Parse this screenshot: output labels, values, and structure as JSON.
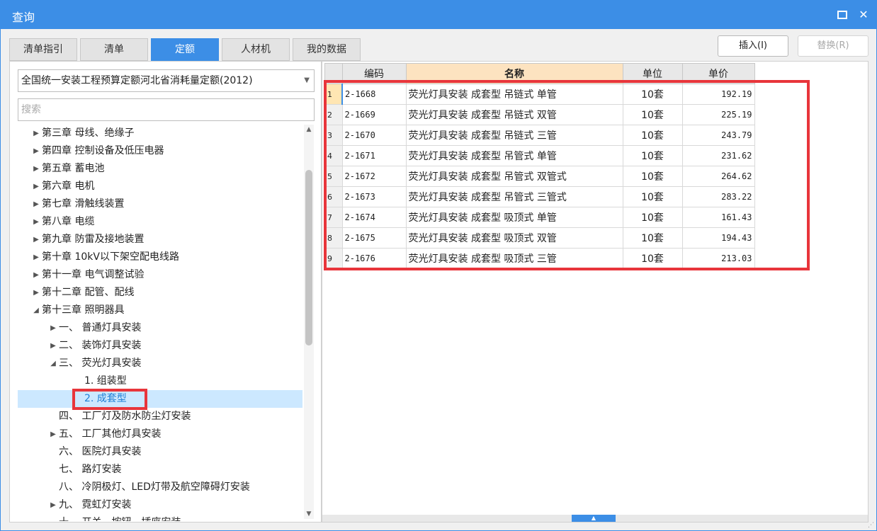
{
  "window": {
    "title": "查询"
  },
  "tabs": [
    {
      "label": "清单指引",
      "active": false
    },
    {
      "label": "清单",
      "active": false
    },
    {
      "label": "定额",
      "active": true
    },
    {
      "label": "人材机",
      "active": false
    },
    {
      "label": "我的数据",
      "active": false
    }
  ],
  "actions": {
    "insert_label": "插入(I)",
    "replace_label": "替换(R)"
  },
  "left": {
    "quota_book": "全国统一安装工程预算定额河北省消耗量定额(2012)",
    "search_placeholder": "搜索",
    "tree": [
      {
        "label": "第三章 母线、绝缘子",
        "toggle": "expand",
        "level": 0
      },
      {
        "label": "第四章 控制设备及低压电器",
        "toggle": "expand",
        "level": 0
      },
      {
        "label": "第五章 蓄电池",
        "toggle": "expand",
        "level": 0
      },
      {
        "label": "第六章 电机",
        "toggle": "expand",
        "level": 0
      },
      {
        "label": "第七章 滑触线装置",
        "toggle": "expand",
        "level": 0
      },
      {
        "label": "第八章 电缆",
        "toggle": "expand",
        "level": 0
      },
      {
        "label": "第九章 防雷及接地装置",
        "toggle": "expand",
        "level": 0
      },
      {
        "label": "第十章 10kV以下架空配电线路",
        "toggle": "expand",
        "level": 0
      },
      {
        "label": "第十一章 电气调整试验",
        "toggle": "expand",
        "level": 0
      },
      {
        "label": "第十二章 配管、配线",
        "toggle": "expand",
        "level": 0
      },
      {
        "label": "第十三章 照明器具",
        "toggle": "collapse",
        "level": 0
      },
      {
        "label": "一、  普通灯具安装",
        "toggle": "expand",
        "level": 1
      },
      {
        "label": "二、  装饰灯具安装",
        "toggle": "expand",
        "level": 1
      },
      {
        "label": "三、  荧光灯具安装",
        "toggle": "collapse",
        "level": 1
      },
      {
        "label": "1. 组装型",
        "toggle": "none",
        "level": 2
      },
      {
        "label": "2. 成套型",
        "toggle": "none",
        "level": 2,
        "selected": true
      },
      {
        "label": "四、  工厂灯及防水防尘灯安装",
        "toggle": "none",
        "level": 1
      },
      {
        "label": "五、  工厂其他灯具安装",
        "toggle": "expand",
        "level": 1
      },
      {
        "label": "六、  医院灯具安装",
        "toggle": "none",
        "level": 1
      },
      {
        "label": "七、  路灯安装",
        "toggle": "none",
        "level": 1
      },
      {
        "label": "八、  冷阴极灯、LED灯带及航空障碍灯安装",
        "toggle": "none",
        "level": 1
      },
      {
        "label": "九、  霓虹灯安装",
        "toggle": "expand",
        "level": 1
      },
      {
        "label": "十、  开关、按钮、插座安装",
        "toggle": "none",
        "level": 1
      }
    ]
  },
  "grid": {
    "headers": {
      "code": "编码",
      "name": "名称",
      "unit": "单位",
      "price": "单价"
    },
    "rows": [
      {
        "no": "1",
        "code": "2-1668",
        "name": "荧光灯具安装 成套型 吊链式 单管",
        "unit": "10套",
        "price": "192.19"
      },
      {
        "no": "2",
        "code": "2-1669",
        "name": "荧光灯具安装 成套型 吊链式 双管",
        "unit": "10套",
        "price": "225.19"
      },
      {
        "no": "3",
        "code": "2-1670",
        "name": "荧光灯具安装 成套型 吊链式 三管",
        "unit": "10套",
        "price": "243.79"
      },
      {
        "no": "4",
        "code": "2-1671",
        "name": "荧光灯具安装 成套型 吊管式 单管",
        "unit": "10套",
        "price": "231.62"
      },
      {
        "no": "5",
        "code": "2-1672",
        "name": "荧光灯具安装 成套型 吊管式 双管式",
        "unit": "10套",
        "price": "264.62"
      },
      {
        "no": "6",
        "code": "2-1673",
        "name": "荧光灯具安装 成套型 吊管式 三管式",
        "unit": "10套",
        "price": "283.22"
      },
      {
        "no": "7",
        "code": "2-1674",
        "name": "荧光灯具安装 成套型 吸顶式 单管",
        "unit": "10套",
        "price": "161.43"
      },
      {
        "no": "8",
        "code": "2-1675",
        "name": "荧光灯具安装 成套型 吸顶式 双管",
        "unit": "10套",
        "price": "194.43"
      },
      {
        "no": "9",
        "code": "2-1676",
        "name": "荧光灯具安装 成套型 吸顶式 三管",
        "unit": "10套",
        "price": "213.03"
      }
    ]
  },
  "colors": {
    "accent": "#3c8ee6",
    "highlight_box": "#e8353b",
    "selected_row": "#cce8ff",
    "header_highlight": "#fde3c0"
  }
}
